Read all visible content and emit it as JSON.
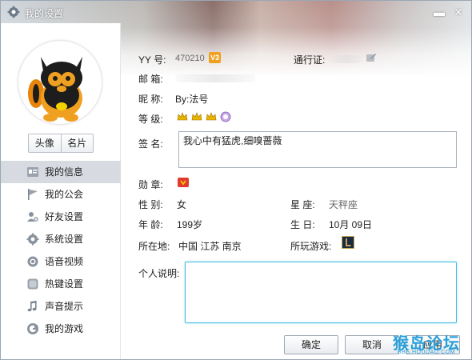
{
  "window": {
    "title": "我的设置",
    "minimize": "▬",
    "close": "✕"
  },
  "left": {
    "tabs": [
      "头像",
      "名片"
    ],
    "nav": [
      {
        "label": "我的信息",
        "icon": "id-card-icon",
        "active": true
      },
      {
        "label": "我的公会",
        "icon": "flag-icon"
      },
      {
        "label": "好友设置",
        "icon": "friend-gear-icon"
      },
      {
        "label": "系统设置",
        "icon": "gear-icon"
      },
      {
        "label": "语音视频",
        "icon": "voice-video-icon"
      },
      {
        "label": "热键设置",
        "icon": "hotkey-icon"
      },
      {
        "label": "声音提示",
        "icon": "music-note-icon"
      },
      {
        "label": "我的游戏",
        "icon": "game-g-icon"
      }
    ]
  },
  "profile": {
    "yy_label": "YY 号:",
    "yy_number": "470210",
    "yy_badge": "V3",
    "passport_label": "通行证:",
    "email_label": "邮  箱:",
    "nickname_label": "昵  称:",
    "nickname": "By:法号",
    "level_label": "等  级:",
    "signature_label": "签  名:",
    "signature": "我心中有猛虎,细嗅蔷薇",
    "medal_label": "勋  章:",
    "gender_label": "性  别:",
    "gender": "女",
    "constellation_label": "星  座:",
    "constellation": "天秤座",
    "age_label": "年  龄:",
    "age": "199岁",
    "birthday_label": "生  日:",
    "birthday": "10月  09日",
    "location_label": "所在地:",
    "location": "中国  江苏  南京",
    "games_label": "所玩游戏:",
    "description_label": "个人说明:"
  },
  "buttons": {
    "ok": "确定",
    "cancel": "取消",
    "apply": "应用"
  },
  "watermark": {
    "brand": "猴岛论坛",
    "url": "BBS.HOUDAO.COM"
  },
  "colors": {
    "accent_input_border": "#48bfe0",
    "nav_active_bg": "#d7dbe1",
    "crown_gold": "#e8b400",
    "watermark_blue": "#2a9fd8"
  }
}
